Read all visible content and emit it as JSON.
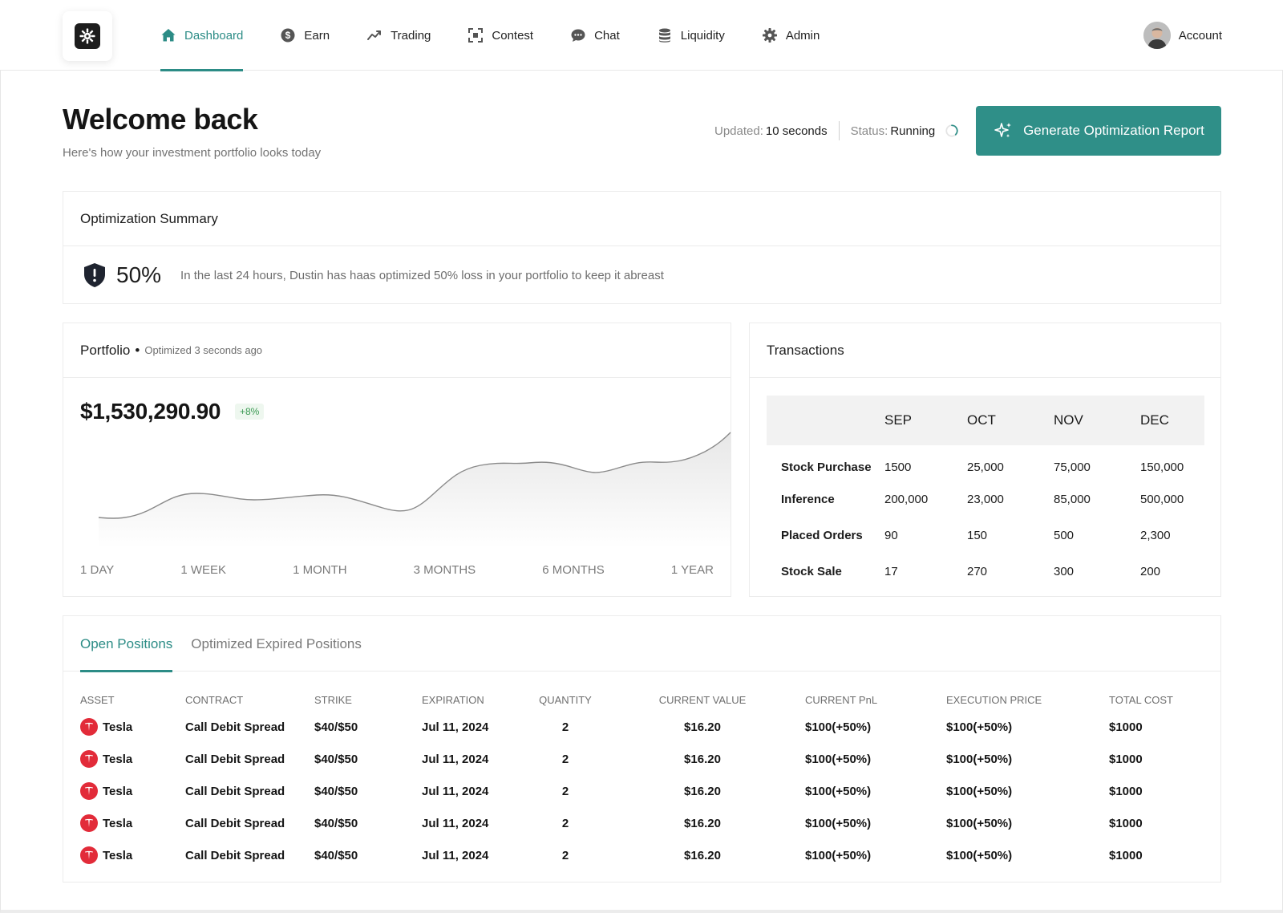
{
  "nav": {
    "items": [
      {
        "label": "Dashboard",
        "icon": "home-icon",
        "active": true
      },
      {
        "label": "Earn",
        "icon": "dollar-coin-icon",
        "active": false
      },
      {
        "label": "Trading",
        "icon": "trend-up-icon",
        "active": false
      },
      {
        "label": "Contest",
        "icon": "expand-icon",
        "active": false
      },
      {
        "label": "Chat",
        "icon": "chat-bubble-icon",
        "active": false
      },
      {
        "label": "Liquidity",
        "icon": "database-icon",
        "active": false
      },
      {
        "label": "Admin",
        "icon": "gear-icon",
        "active": false
      }
    ],
    "account_label": "Account"
  },
  "header": {
    "title": "Welcome back",
    "subtitle": "Here's how your investment portfolio looks today",
    "updated_label": "Updated:",
    "updated_value": "10 seconds",
    "status_label": "Status:",
    "status_value": "Running",
    "generate_button": "Generate Optimization Report"
  },
  "optimization": {
    "title": "Optimization Summary",
    "percent": "50%",
    "message": "In the last 24 hours, Dustin has haas optimized 50% loss in your portfolio to keep it abreast"
  },
  "portfolio": {
    "title": "Portfolio",
    "subtitle": "Optimized 3 seconds ago",
    "value": "$1,530,290.90",
    "change": "+8%",
    "ranges": [
      "1 DAY",
      "1 WEEK",
      "1 MONTH",
      "3 MONTHS",
      "6 MONTHS",
      "1 YEAR"
    ]
  },
  "transactions": {
    "title": "Transactions",
    "columns": [
      "SEP",
      "OCT",
      "NOV",
      "DEC"
    ],
    "rows": [
      {
        "label": "Stock Purchase",
        "values": [
          "1500",
          "25,000",
          "75,000",
          "150,000"
        ]
      },
      {
        "label": "Inference",
        "values": [
          "200,000",
          "23,000",
          "85,000",
          "500,000"
        ]
      },
      {
        "label": "Placed Orders",
        "values": [
          "90",
          "150",
          "500",
          "2,300"
        ]
      },
      {
        "label": "Stock Sale",
        "values": [
          "17",
          "270",
          "300",
          "200"
        ]
      }
    ]
  },
  "positions": {
    "tabs": [
      {
        "label": "Open Positions",
        "active": true
      },
      {
        "label": "Optimized Expired Positions",
        "active": false
      }
    ],
    "columns": [
      "ASSET",
      "CONTRACT",
      "STRIKE",
      "EXPIRATION",
      "QUANTITY",
      "CURRENT VALUE",
      "CURRENT PnL",
      "EXECUTION PRICE",
      "TOTAL COST"
    ],
    "rows": [
      {
        "asset": "Tesla",
        "contract": "Call Debit Spread",
        "strike": "$40/$50",
        "expiration": "Jul 11, 2024",
        "quantity": "2",
        "current_value": "$16.20",
        "pnl": "$100(+50%)",
        "execution_price": "$100(+50%)",
        "total_cost": "$1000"
      },
      {
        "asset": "Tesla",
        "contract": "Call Debit Spread",
        "strike": "$40/$50",
        "expiration": "Jul 11, 2024",
        "quantity": "2",
        "current_value": "$16.20",
        "pnl": "$100(+50%)",
        "execution_price": "$100(+50%)",
        "total_cost": "$1000"
      },
      {
        "asset": "Tesla",
        "contract": "Call Debit Spread",
        "strike": "$40/$50",
        "expiration": "Jul 11, 2024",
        "quantity": "2",
        "current_value": "$16.20",
        "pnl": "$100(+50%)",
        "execution_price": "$100(+50%)",
        "total_cost": "$1000"
      },
      {
        "asset": "Tesla",
        "contract": "Call Debit Spread",
        "strike": "$40/$50",
        "expiration": "Jul 11, 2024",
        "quantity": "2",
        "current_value": "$16.20",
        "pnl": "$100(+50%)",
        "execution_price": "$100(+50%)",
        "total_cost": "$1000"
      },
      {
        "asset": "Tesla",
        "contract": "Call Debit Spread",
        "strike": "$40/$50",
        "expiration": "Jul 11, 2024",
        "quantity": "2",
        "current_value": "$16.20",
        "pnl": "$100(+50%)",
        "execution_price": "$100(+50%)",
        "total_cost": "$1000"
      }
    ]
  },
  "colors": {
    "accent": "#2f8f88",
    "positive": "#3c9a54",
    "tesla_red": "#e22b39"
  }
}
